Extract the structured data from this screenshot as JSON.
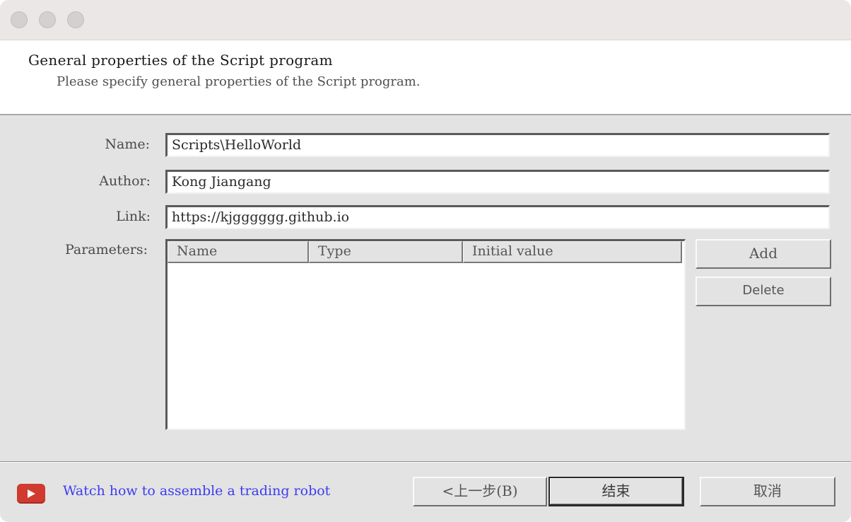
{
  "window": {
    "controls": [
      "close",
      "minimize",
      "zoom"
    ]
  },
  "header": {
    "title": "General properties of the Script program",
    "subtitle": "Please specify general properties of the Script program."
  },
  "form": {
    "name_label": "Name:",
    "name_value": "Scripts\\HelloWorld",
    "author_label": "Author:",
    "author_value": "Kong Jiangang",
    "link_label": "Link:",
    "link_value": "https://kjgggggg.github.io",
    "parameters_label": "Parameters:"
  },
  "parameters_table": {
    "columns": [
      "Name",
      "Type",
      "Initial value"
    ],
    "rows": []
  },
  "side_buttons": {
    "add_label": "Add",
    "delete_label": "Delete"
  },
  "footer": {
    "video_icon": "youtube-play-icon",
    "video_icon_color": "#d03a2f",
    "link_text": "Watch how to assemble a trading robot",
    "link_color": "#3c3cf0",
    "back_label": "<上一步(B)",
    "finish_label": "结束",
    "cancel_label": "取消"
  }
}
